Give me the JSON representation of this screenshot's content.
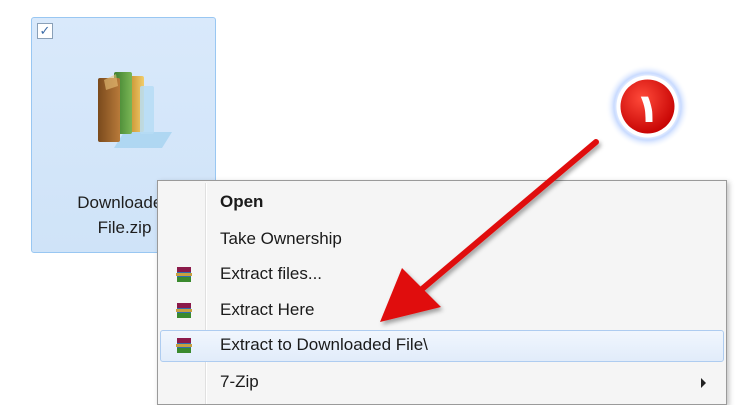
{
  "file": {
    "name_line1": "Downloaded",
    "name_line2": "File.zip",
    "checked": true,
    "icon": "zip-archive-icon"
  },
  "context_menu": {
    "items": [
      {
        "label": "Open",
        "bold": true,
        "icon": null
      },
      {
        "label": "Take Ownership",
        "icon": null
      },
      {
        "label": "Extract files...",
        "icon": "winrar-icon"
      },
      {
        "label": "Extract Here",
        "icon": "winrar-icon"
      },
      {
        "label": "Extract to Downloaded File\\",
        "icon": "winrar-icon",
        "highlighted": true
      },
      {
        "label": "7-Zip",
        "icon": null,
        "submenu": true
      }
    ]
  },
  "annotation": {
    "badge_text": "١",
    "badge_color": "#e01010",
    "arrow_color": "#e01010"
  }
}
